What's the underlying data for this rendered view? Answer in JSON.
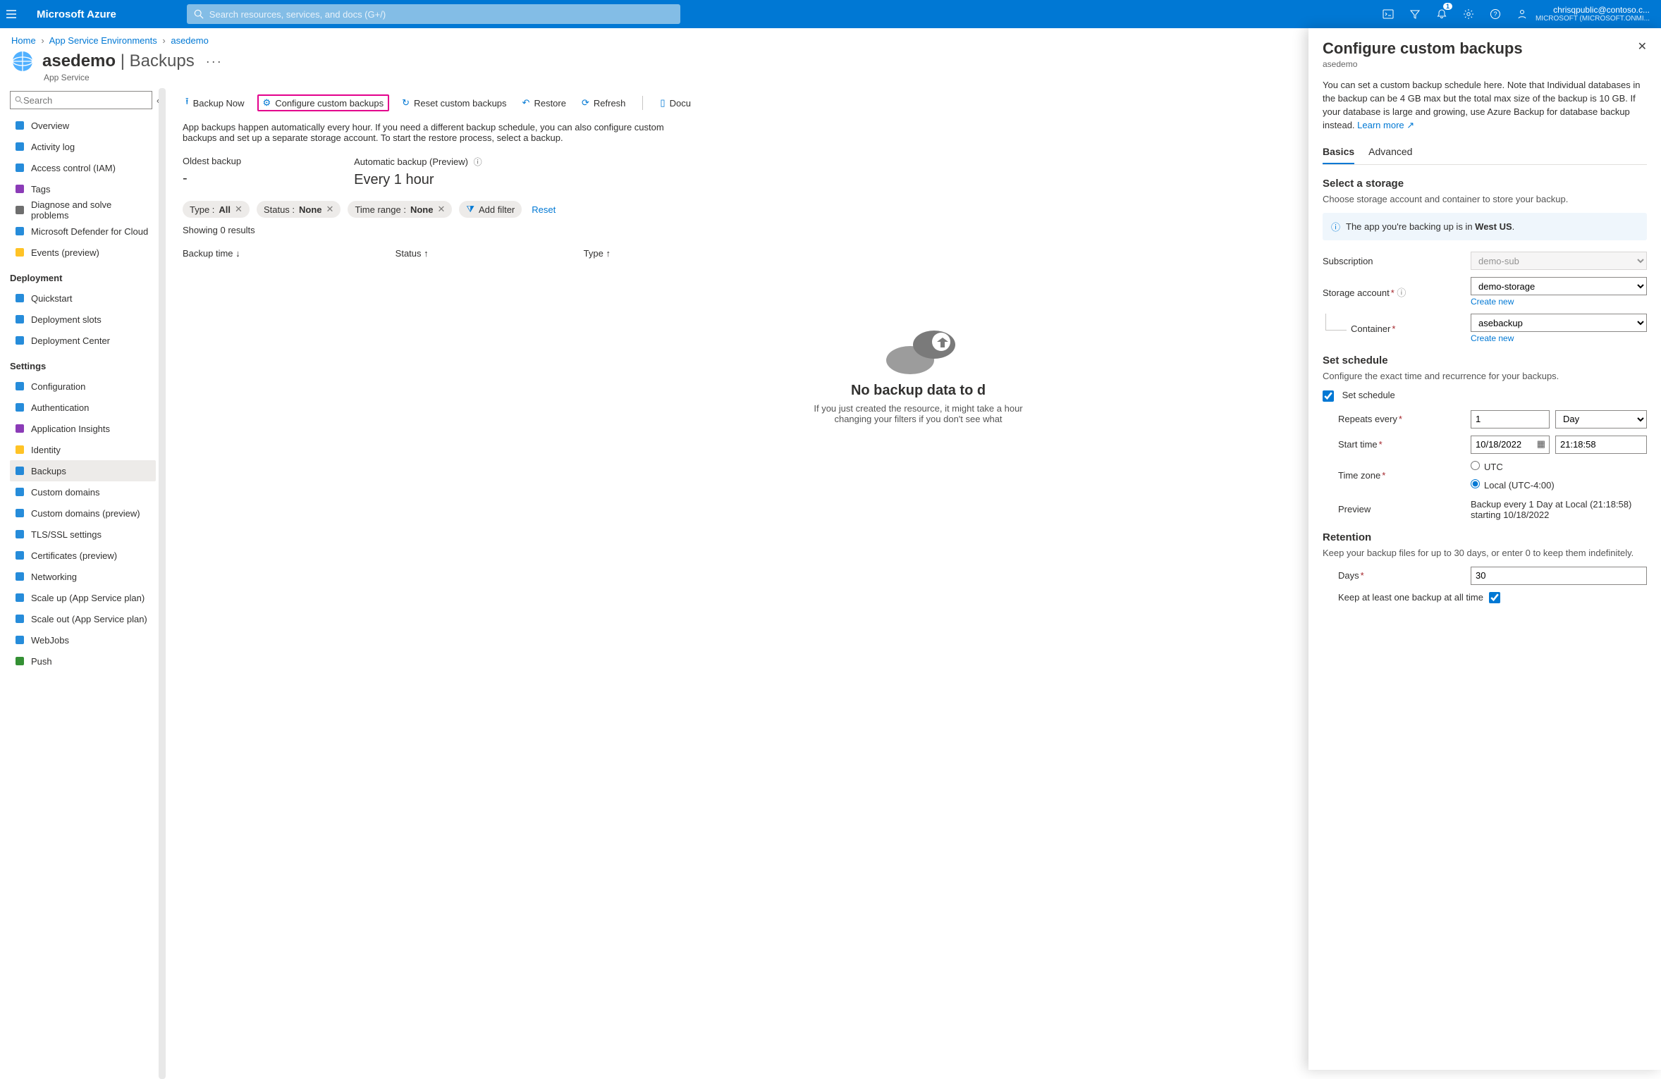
{
  "topbar": {
    "brand": "Microsoft Azure",
    "search_placeholder": "Search resources, services, and docs (G+/)",
    "notif_badge": "1",
    "account_line1": "chrisqpublic@contoso.c...",
    "account_line2": "MICROSOFT (MICROSOFT.ONMI..."
  },
  "breadcrumb": {
    "items": [
      "Home",
      "App Service Environments",
      "asedemo"
    ]
  },
  "page": {
    "resource": "asedemo",
    "section": "Backups",
    "subtype": "App Service"
  },
  "sidebar": {
    "search_placeholder": "Search",
    "overview": [
      {
        "label": "Overview",
        "icon": "globe",
        "color": "#0078d4"
      },
      {
        "label": "Activity log",
        "icon": "log",
        "color": "#0078d4"
      },
      {
        "label": "Access control (IAM)",
        "icon": "people",
        "color": "#0078d4"
      },
      {
        "label": "Tags",
        "icon": "tag",
        "color": "#7719aa"
      },
      {
        "label": "Diagnose and solve problems",
        "icon": "wrench",
        "color": "#555"
      },
      {
        "label": "Microsoft Defender for Cloud",
        "icon": "shield",
        "color": "#0078d4"
      },
      {
        "label": "Events (preview)",
        "icon": "bolt",
        "color": "#ffb900"
      }
    ],
    "grp_deployment": "Deployment",
    "deployment": [
      {
        "label": "Quickstart",
        "icon": "rocket",
        "color": "#0078d4"
      },
      {
        "label": "Deployment slots",
        "icon": "slots",
        "color": "#0078d4"
      },
      {
        "label": "Deployment Center",
        "icon": "center",
        "color": "#0078d4"
      }
    ],
    "grp_settings": "Settings",
    "settings": [
      {
        "label": "Configuration",
        "icon": "sliders",
        "color": "#0078d4"
      },
      {
        "label": "Authentication",
        "icon": "person",
        "color": "#0078d4"
      },
      {
        "label": "Application Insights",
        "icon": "bulb",
        "color": "#7719aa"
      },
      {
        "label": "Identity",
        "icon": "ribbon",
        "color": "#ffb900"
      },
      {
        "label": "Backups",
        "icon": "backup",
        "color": "#0078d4",
        "active": true
      },
      {
        "label": "Custom domains",
        "icon": "domain",
        "color": "#0078d4"
      },
      {
        "label": "Custom domains (preview)",
        "icon": "domain",
        "color": "#0078d4"
      },
      {
        "label": "TLS/SSL settings",
        "icon": "shield",
        "color": "#0078d4"
      },
      {
        "label": "Certificates (preview)",
        "icon": "cert",
        "color": "#0078d4"
      },
      {
        "label": "Networking",
        "icon": "net",
        "color": "#0078d4"
      },
      {
        "label": "Scale up (App Service plan)",
        "icon": "scaleup",
        "color": "#0078d4"
      },
      {
        "label": "Scale out (App Service plan)",
        "icon": "scaleout",
        "color": "#0078d4"
      },
      {
        "label": "WebJobs",
        "icon": "webjobs",
        "color": "#0078d4"
      },
      {
        "label": "Push",
        "icon": "push",
        "color": "#107c10"
      }
    ]
  },
  "toolbar": {
    "backup_now": "Backup Now",
    "configure": "Configure custom backups",
    "reset": "Reset custom backups",
    "restore": "Restore",
    "refresh": "Refresh",
    "docs": "Docu"
  },
  "desc": "App backups happen automatically every hour. If you need a different backup schedule, you can also configure custom backups and set up a separate storage account. To start the restore process, select a backup.",
  "stats": {
    "oldest_label": "Oldest backup",
    "oldest_value": "-",
    "auto_label": "Automatic backup (Preview)",
    "auto_value": "Every 1 hour"
  },
  "filters": {
    "type": {
      "label": "Type : ",
      "value": "All"
    },
    "status": {
      "label": "Status : ",
      "value": "None"
    },
    "range": {
      "label": "Time range : ",
      "value": "None"
    },
    "add": "Add filter",
    "reset": "Reset"
  },
  "results": "Showing 0 results",
  "columns": {
    "time": "Backup time",
    "status": "Status",
    "type": "Type"
  },
  "empty": {
    "title": "No backup data to d",
    "line1": "If you just created the resource, it might take a hour",
    "line2": "changing your filters if you don't see what"
  },
  "panel": {
    "title": "Configure custom backups",
    "sub": "asedemo",
    "desc": "You can set a custom backup schedule here. Note that Individual databases in the backup can be 4 GB max but the total max size of the backup is 10 GB. If your database is large and growing, use Azure Backup for database backup instead. ",
    "learn_more": "Learn more",
    "tab_basics": "Basics",
    "tab_advanced": "Advanced",
    "storage_h": "Select a storage",
    "storage_hint": "Choose storage account and container to store your backup.",
    "info_prefix": "The app you're backing up is in ",
    "info_region": "West US",
    "subscription_label": "Subscription",
    "subscription_value": "demo-sub",
    "storage_account_label": "Storage account",
    "storage_account_value": "demo-storage",
    "container_label": "Container",
    "container_value": "asebackup",
    "create_new": "Create new",
    "schedule_h": "Set schedule",
    "schedule_hint": "Configure the exact time and recurrence for your backups.",
    "set_schedule": "Set schedule",
    "repeats_label": "Repeats every",
    "repeats_value": "1",
    "repeats_unit": "Day",
    "start_label": "Start time",
    "start_date": "10/18/2022",
    "start_time": "21:18:58",
    "tz_label": "Time zone",
    "tz_utc": "UTC",
    "tz_local": "Local (UTC-4:00)",
    "preview_label": "Preview",
    "preview_text": "Backup every 1 Day at Local (21:18:58) starting 10/18/2022",
    "retention_h": "Retention",
    "retention_hint": "Keep your backup files for up to 30 days, or enter 0 to keep them indefinitely.",
    "days_label": "Days",
    "days_value": "30",
    "keep_one": "Keep at least one backup at all time"
  }
}
